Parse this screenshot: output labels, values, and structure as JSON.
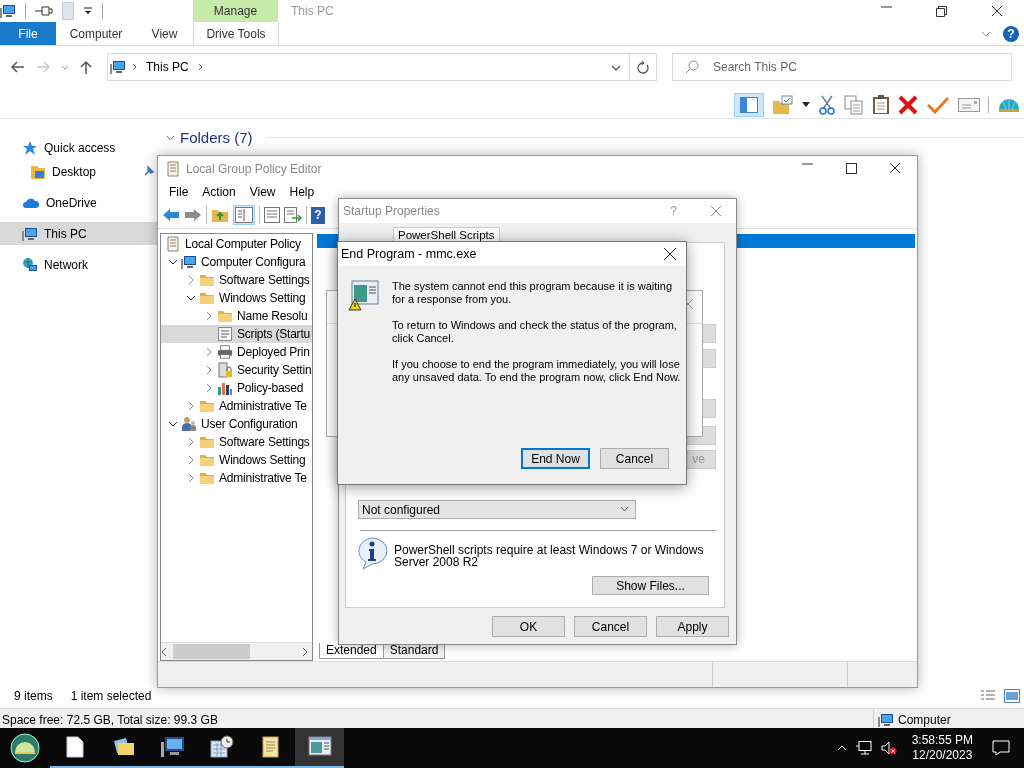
{
  "explorer": {
    "title": "This PC",
    "context_tab": "Manage",
    "help_button": "?",
    "ribbon_tabs": [
      {
        "label": "File",
        "kind": "file",
        "selected": false
      },
      {
        "label": "Computer",
        "kind": "tab",
        "selected": false
      },
      {
        "label": "View",
        "kind": "tab",
        "selected": false
      },
      {
        "label": "Drive Tools",
        "kind": "context",
        "selected": false
      }
    ],
    "address": {
      "path": "This PC"
    },
    "search": {
      "placeholder": "Search This PC"
    },
    "nav": [
      {
        "label": "Quick access",
        "kind": "star",
        "selected": false,
        "children": [
          {
            "label": "Desktop",
            "kind": "desktop",
            "selected": false,
            "pinned": true
          }
        ]
      },
      {
        "label": "OneDrive",
        "kind": "cloud",
        "selected": false
      },
      {
        "label": "This PC",
        "kind": "computer",
        "selected": true
      },
      {
        "label": "Network",
        "kind": "network",
        "selected": false
      }
    ],
    "section": "Folders (7)",
    "status": {
      "items": "9 items",
      "selection": "1 item selected"
    },
    "drive_status": {
      "space": "Space free: 72.5 GB, Total size: 99.3 GB",
      "location": "Computer"
    }
  },
  "gpedit": {
    "title": "Local Group Policy Editor",
    "menu": [
      "File",
      "Action",
      "View",
      "Help"
    ],
    "help_button": "?",
    "tree": [
      {
        "label": "Local Computer Policy",
        "kind": "policy",
        "selected": false,
        "children": [
          {
            "label": "Computer Configura",
            "kind": "computer",
            "selected": false,
            "expanded": true,
            "children": [
              {
                "label": "Software Settings",
                "kind": "folder",
                "selected": false,
                "expanded": false
              },
              {
                "label": "Windows Setting",
                "kind": "folder",
                "selected": false,
                "expanded": true,
                "children": [
                  {
                    "label": "Name Resolu",
                    "kind": "folder",
                    "selected": false,
                    "expanded": false
                  },
                  {
                    "label": "Scripts (Startu",
                    "kind": "script",
                    "selected": true
                  },
                  {
                    "label": "Deployed Prin",
                    "kind": "printer",
                    "selected": false,
                    "expanded": false
                  },
                  {
                    "label": "Security Settin",
                    "kind": "security",
                    "selected": false,
                    "expanded": false
                  },
                  {
                    "label": "Policy-based",
                    "kind": "chart",
                    "selected": false,
                    "expanded": false
                  }
                ]
              },
              {
                "label": "Administrative Te",
                "kind": "folder",
                "selected": false,
                "expanded": false
              }
            ]
          },
          {
            "label": "User Configuration",
            "kind": "user",
            "selected": false,
            "expanded": true,
            "children": [
              {
                "label": "Software Settings",
                "kind": "folder",
                "selected": false,
                "expanded": false
              },
              {
                "label": "Windows Setting",
                "kind": "folder",
                "selected": false,
                "expanded": false
              },
              {
                "label": "Administrative Te",
                "kind": "folder",
                "selected": false,
                "expanded": false
              }
            ]
          }
        ]
      }
    ],
    "view_tabs": [
      {
        "label": "Extended",
        "selected": true
      },
      {
        "label": "Standard",
        "selected": false
      }
    ]
  },
  "startup_dialog": {
    "title": "Startup Properties",
    "help_button": "?",
    "tabs": [
      {
        "label": "PowerShell Scripts",
        "selected": true
      }
    ],
    "side_button": "ve",
    "order": {
      "value": "Not configured"
    },
    "note": "PowerShell scripts require at least Windows 7 or Windows Server 2008 R2",
    "show_files": "Show Files...",
    "buttons": [
      "OK",
      "Cancel",
      "Apply"
    ]
  },
  "end_program": {
    "title": "End Program - mmc.exe",
    "paragraphs": [
      "The system cannot end this program because it is waiting for a response from you.",
      "To return to Windows and check the status of the program, click Cancel.",
      "If you choose to end the program immediately, you will lose any unsaved data. To end the program now, click End Now."
    ],
    "buttons": [
      {
        "label": "End Now",
        "default": true
      },
      {
        "label": "Cancel",
        "default": false
      }
    ]
  },
  "taskbar": {
    "apps": [
      {
        "kind": "document",
        "running": true,
        "active": false
      },
      {
        "kind": "folders",
        "running": true,
        "active": false
      },
      {
        "kind": "computer",
        "running": true,
        "active": false
      },
      {
        "kind": "calendar",
        "running": true,
        "active": false
      },
      {
        "kind": "scroll",
        "running": true,
        "active": false
      },
      {
        "kind": "console",
        "running": true,
        "active": true
      }
    ],
    "time": "3:58:55 PM",
    "date": "12/20/2023"
  }
}
